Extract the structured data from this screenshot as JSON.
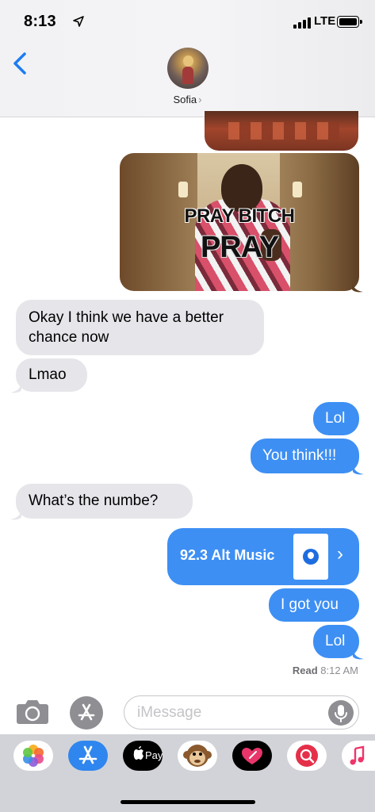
{
  "status": {
    "time": "8:13",
    "network": "LTE"
  },
  "header": {
    "contact_name": "Sofia",
    "contact_chevron": "›"
  },
  "messages": {
    "gif_caption_line1": "PRAY BITCH",
    "gif_caption_line2": "PRAY",
    "m1": "Okay I think we have a better chance now",
    "m2": "Lmao",
    "m3": "Lol",
    "m4": "You think!!!",
    "m5": "What’s the numbe?",
    "link_title": "92.3 Alt Music",
    "m6": "I got you",
    "m7": "Lol",
    "read_label": "Read",
    "read_time": "8:12 AM"
  },
  "input": {
    "placeholder": "iMessage"
  },
  "apps": [
    "Photos",
    "App Store",
    "Apple Pay",
    "Animoji",
    "Digital Touch",
    "Search Images",
    "Music"
  ],
  "colors": {
    "outgoing": "#3d8ff3",
    "incoming": "#e5e5ea",
    "accent": "#1d7cf2"
  }
}
